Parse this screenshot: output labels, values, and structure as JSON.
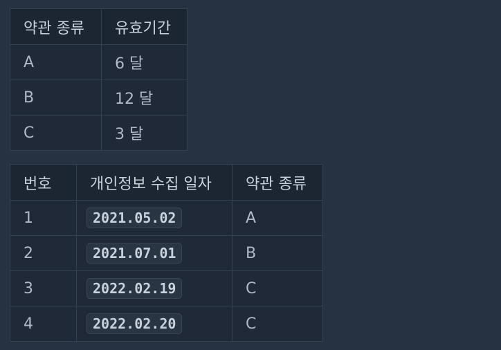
{
  "terms_table": {
    "headers": [
      "약관 종류",
      "유효기간"
    ],
    "rows": [
      [
        "A",
        "6 달"
      ],
      [
        "B",
        "12 달"
      ],
      [
        "C",
        "3 달"
      ]
    ]
  },
  "privacy_table": {
    "headers": [
      "번호",
      "개인정보 수집 일자",
      "약관 종류"
    ],
    "rows": [
      [
        "1",
        "2021.05.02",
        "A"
      ],
      [
        "2",
        "2021.07.01",
        "B"
      ],
      [
        "3",
        "2022.02.19",
        "C"
      ],
      [
        "4",
        "2022.02.20",
        "C"
      ]
    ]
  },
  "colors": {
    "background": "#263241",
    "table_bg": "#1f2937",
    "border": "#344153",
    "text": "#b7c1cd"
  }
}
